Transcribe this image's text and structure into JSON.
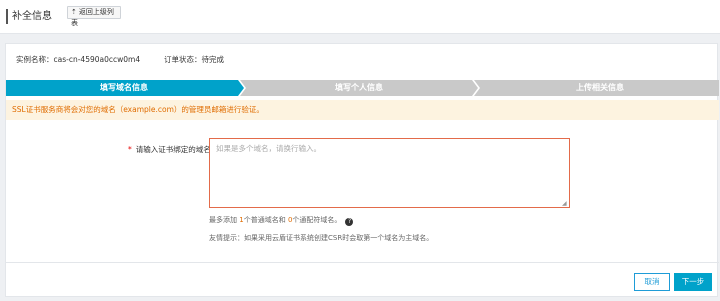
{
  "header": {
    "title": "补全信息",
    "back_label": "返回上级列表"
  },
  "meta": {
    "instance": "实例名称：cas-cn-4590a0ccw0m4",
    "status": "订单状态：待完成"
  },
  "steps": [
    {
      "label": "填写域名信息",
      "active": true
    },
    {
      "label": "填写个人信息",
      "active": false
    },
    {
      "label": "上传相关信息",
      "active": false
    }
  ],
  "colors": {
    "step_active": "#00a2ca",
    "step_inactive": "#c9c9c9",
    "notice_bg": "#fdf3e0",
    "notice_text": "#e06c00",
    "accent": "#1e9cd7"
  },
  "notice": "SSL证书服务商将会对您的域名（example.com）的管理员邮箱进行验证。",
  "form": {
    "required_mark": "*",
    "label": "请输入证书绑定的域名:",
    "placeholder": "如果是多个域名，请换行输入。",
    "value": "",
    "limit_prefix": "最多添加 ",
    "limit_normal_count": "1",
    "limit_middle": "个普通域名和 ",
    "limit_wildcard_count": "0",
    "limit_suffix": "个通配符域名。",
    "help_icon": "question-circle-icon",
    "tip": "友情提示：如果采用云盾证书系统创建CSR时会取第一个域名为主域名。"
  },
  "footer": {
    "cancel_label": "取消",
    "next_label": "下一步"
  }
}
